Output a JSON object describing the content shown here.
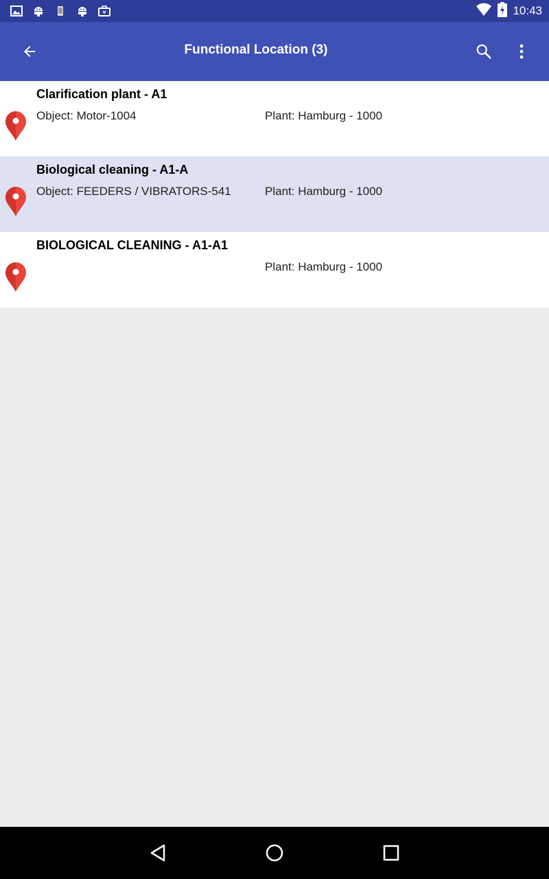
{
  "status_bar": {
    "time": "10:43",
    "notification_icons": [
      "image-icon",
      "android-icon",
      "device-icon",
      "android-icon",
      "briefcase-icon"
    ],
    "system_icons": [
      "wifi-icon",
      "battery-charging-icon"
    ]
  },
  "app_bar": {
    "title": "Functional Location (3)",
    "back_icon": "arrow-back-icon",
    "search_icon": "search-icon",
    "menu_icon": "more-vert-icon"
  },
  "list": {
    "items": [
      {
        "title": "Clarification plant - A1",
        "object": "Object: Motor-1004",
        "plant": "Plant: Hamburg - 1000",
        "selected": false
      },
      {
        "title": "Biological cleaning - A1-A",
        "object": "Object: FEEDERS / VIBRATORS-541",
        "plant": "Plant: Hamburg - 1000",
        "selected": true
      },
      {
        "title": "BIOLOGICAL CLEANING - A1-A1",
        "object": "",
        "plant": "Plant: Hamburg - 1000",
        "selected": false
      }
    ]
  },
  "nav_bar": {
    "buttons": [
      "back-triangle-icon",
      "home-circle-icon",
      "recents-square-icon"
    ]
  },
  "colors": {
    "status_bar": "#2e3d9a",
    "app_bar": "#3f51b5",
    "selected_row": "#dde1f1",
    "pin": "#e8453c",
    "background": "#ececec"
  }
}
